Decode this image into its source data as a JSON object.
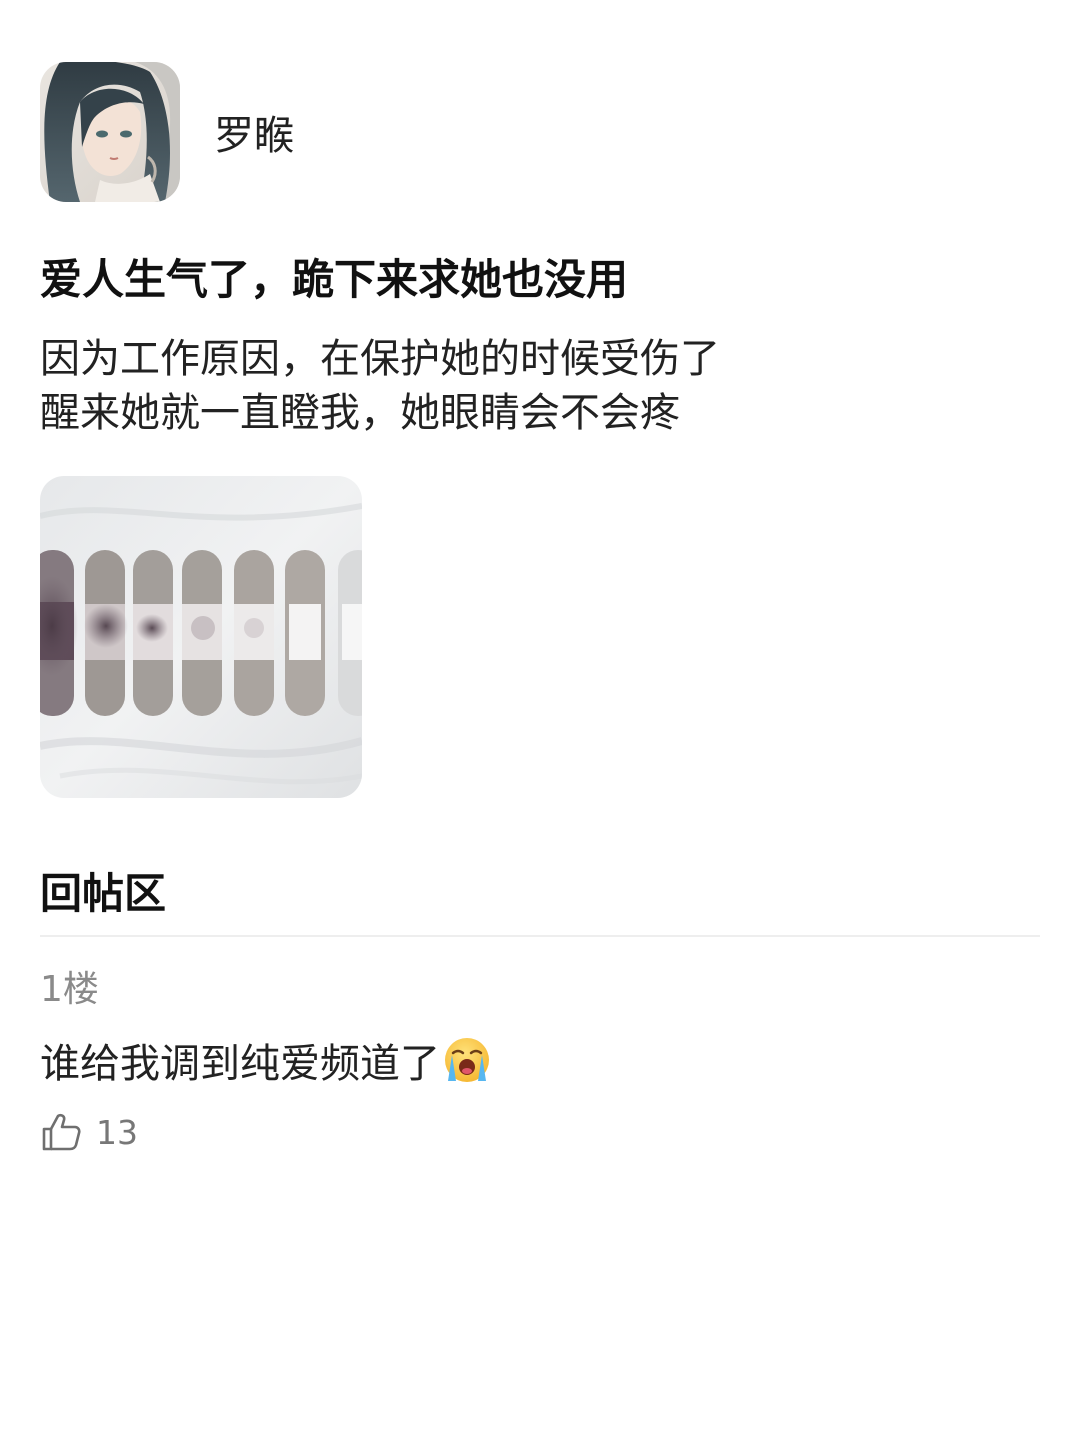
{
  "author": {
    "name": "罗睺",
    "avatar_icon": "anime-girl-avatar"
  },
  "post": {
    "title": "爱人生气了，跪下来求她也没用",
    "body_lines": [
      "因为工作原因，在保护她的时候受伤了",
      "醒来她就一直瞪我，她眼睛会不会疼"
    ],
    "image_icon": "bandages-photo"
  },
  "replies": {
    "heading": "回帖区",
    "items": [
      {
        "floor": "1楼",
        "text": "谁给我调到纯爱频道了",
        "emoji": "loudly-crying-face-icon",
        "likes": "13"
      }
    ]
  },
  "colors": {
    "text_primary": "#111111",
    "text_secondary": "#8a8a8a",
    "divider": "#eeeeee"
  }
}
